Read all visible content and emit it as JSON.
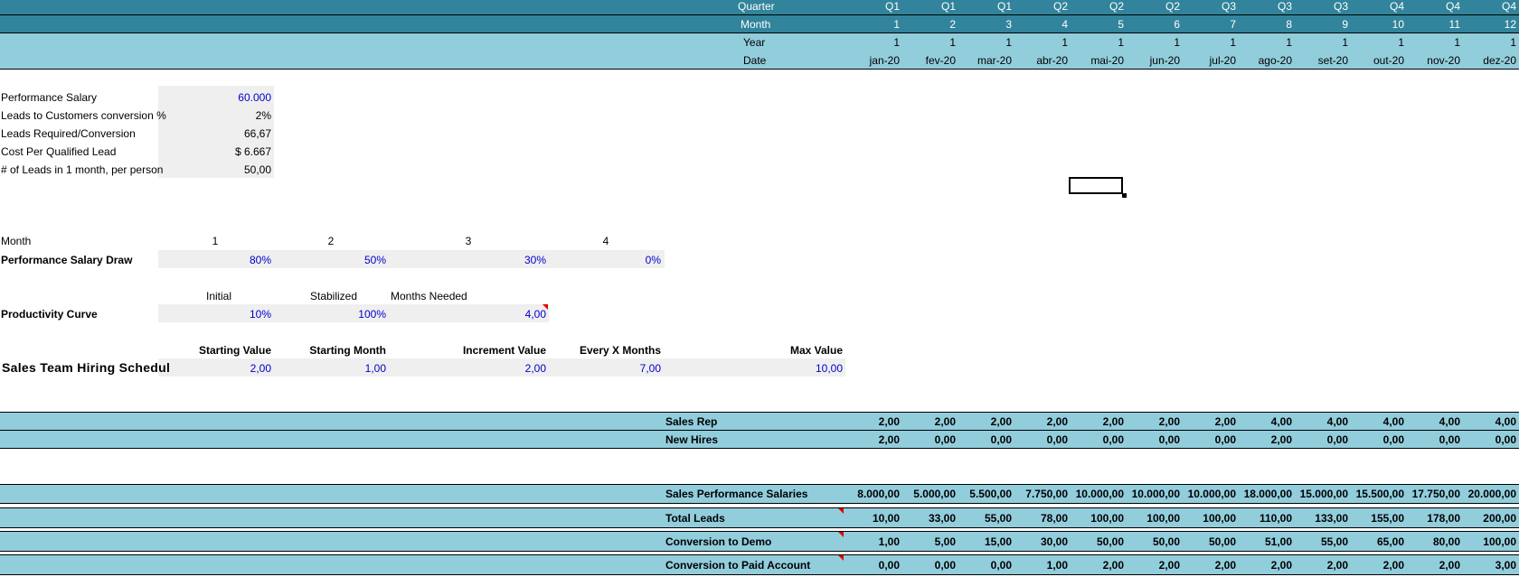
{
  "header": {
    "quarter_label": "Quarter",
    "month_label": "Month",
    "year_label": "Year",
    "date_label": "Date",
    "quarters": [
      "Q1",
      "Q1",
      "Q1",
      "Q2",
      "Q2",
      "Q2",
      "Q3",
      "Q3",
      "Q3",
      "Q4",
      "Q4",
      "Q4"
    ],
    "months": [
      "1",
      "2",
      "3",
      "4",
      "5",
      "6",
      "7",
      "8",
      "9",
      "10",
      "11",
      "12"
    ],
    "years": [
      "1",
      "1",
      "1",
      "1",
      "1",
      "1",
      "1",
      "1",
      "1",
      "1",
      "1",
      "1"
    ],
    "dates": [
      "jan-20",
      "fev-20",
      "mar-20",
      "abr-20",
      "mai-20",
      "jun-20",
      "jul-20",
      "ago-20",
      "set-20",
      "out-20",
      "nov-20",
      "dez-20"
    ]
  },
  "assumptions": [
    {
      "label": "Performance Salary",
      "value": "60.000",
      "blue": true
    },
    {
      "label": "Leads to Customers conversion %",
      "value": "2%",
      "blue": false
    },
    {
      "label": "Leads Required/Conversion",
      "value": "66,67",
      "blue": false
    },
    {
      "label": "Cost Per Qualified Lead",
      "value": "$ 6.667",
      "blue": false
    },
    {
      "label": "# of Leads in 1 month, per person",
      "value": "50,00",
      "blue": false
    }
  ],
  "draw": {
    "month_label": "Month",
    "month_numbers": [
      "1",
      "2",
      "3",
      "4"
    ],
    "label": "Performance Salary Draw",
    "values": [
      "80%",
      "50%",
      "30%",
      "0%"
    ]
  },
  "productivity": {
    "headers": [
      "Initial",
      "Stabilized",
      "Months Needed"
    ],
    "label": "Productivity Curve",
    "values": [
      "10%",
      "100%",
      "4,00"
    ]
  },
  "hiring": {
    "headers": [
      "Starting Value",
      "Starting Month",
      "Increment Value",
      "Every X Months",
      "Max Value"
    ],
    "label": "Sales Team Hiring Schedul",
    "values": [
      "2,00",
      "1,00",
      "2,00",
      "7,00",
      "10,00"
    ]
  },
  "rows": [
    {
      "label": "Sales Rep",
      "values": [
        "2,00",
        "2,00",
        "2,00",
        "2,00",
        "2,00",
        "2,00",
        "2,00",
        "4,00",
        "4,00",
        "4,00",
        "4,00",
        "4,00"
      ]
    },
    {
      "label": "New Hires",
      "values": [
        "2,00",
        "0,00",
        "0,00",
        "0,00",
        "0,00",
        "0,00",
        "0,00",
        "2,00",
        "0,00",
        "0,00",
        "0,00",
        "0,00"
      ]
    },
    {
      "label": "Sales Performance Salaries",
      "values": [
        "8.000,00",
        "5.000,00",
        "5.500,00",
        "7.750,00",
        "10.000,00",
        "10.000,00",
        "10.000,00",
        "18.000,00",
        "15.000,00",
        "15.500,00",
        "17.750,00",
        "20.000,00"
      ]
    },
    {
      "label": "Total Leads",
      "values": [
        "10,00",
        "33,00",
        "55,00",
        "78,00",
        "100,00",
        "100,00",
        "100,00",
        "110,00",
        "133,00",
        "155,00",
        "178,00",
        "200,00"
      ]
    },
    {
      "label": "Conversion to Demo",
      "values": [
        "1,00",
        "5,00",
        "15,00",
        "30,00",
        "50,00",
        "50,00",
        "50,00",
        "51,00",
        "55,00",
        "65,00",
        "80,00",
        "100,00"
      ]
    },
    {
      "label": "Conversion to Paid Account",
      "values": [
        "0,00",
        "0,00",
        "0,00",
        "1,00",
        "2,00",
        "2,00",
        "2,00",
        "2,00",
        "2,00",
        "2,00",
        "2,00",
        "3,00"
      ]
    }
  ]
}
